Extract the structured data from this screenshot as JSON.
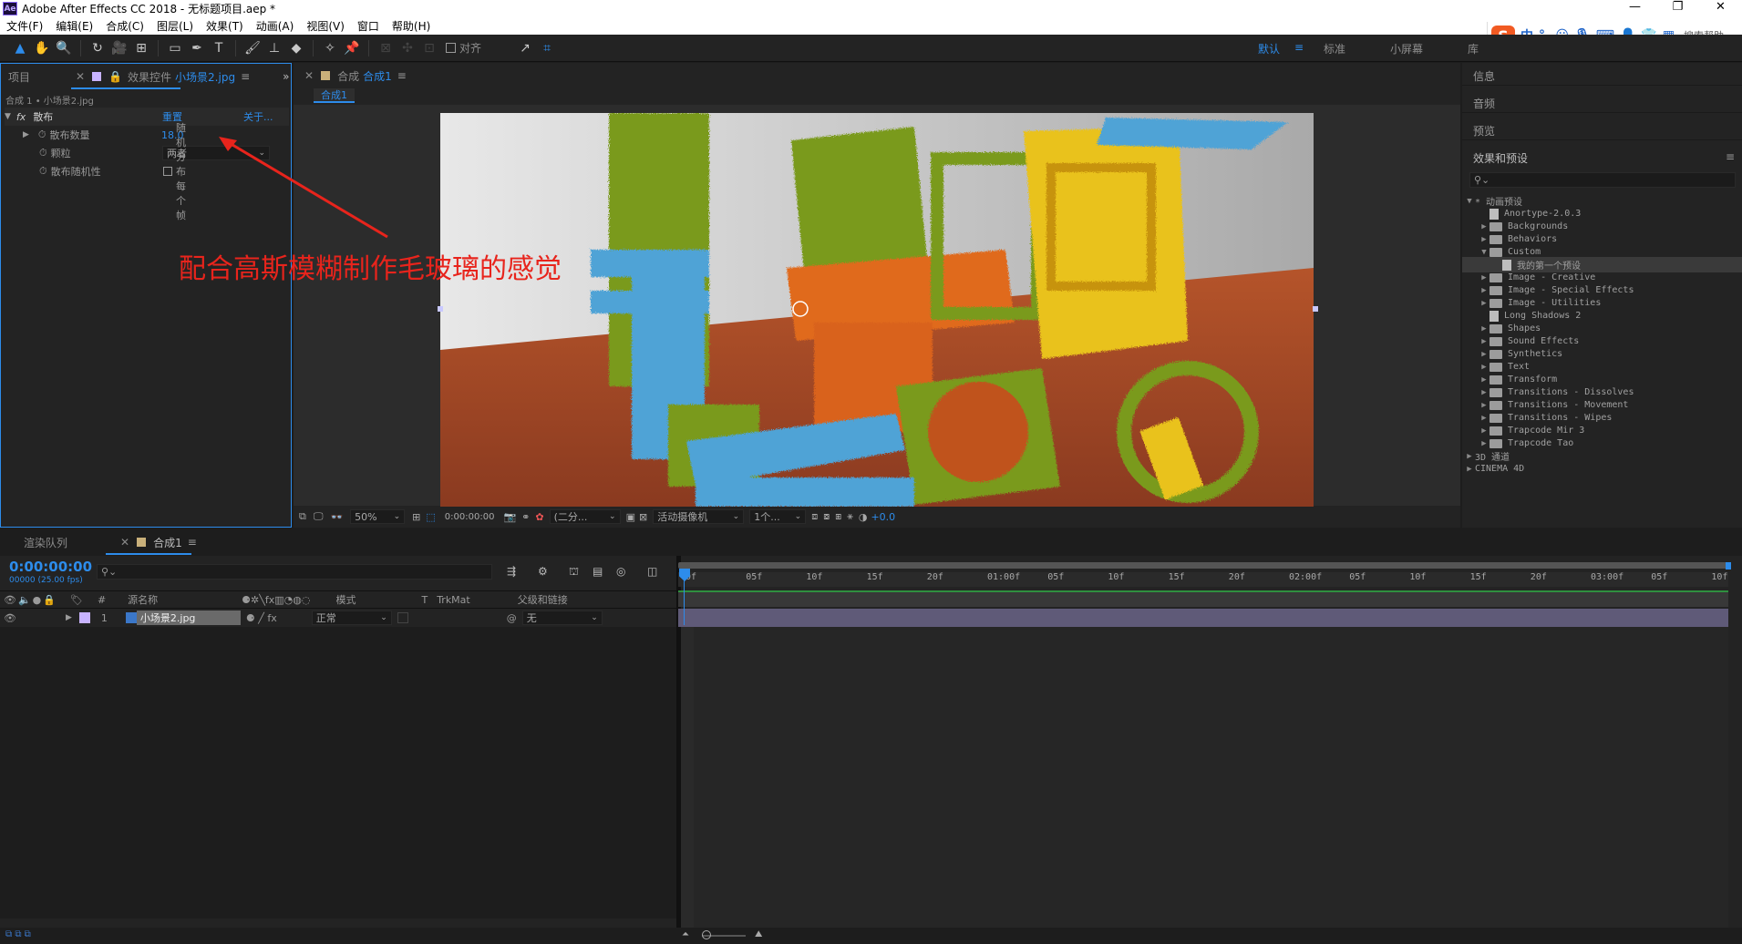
{
  "window": {
    "title": "Adobe After Effects CC 2018 - 无标题项目.aep *",
    "app_icon": "Ae",
    "controls": [
      "—",
      "❐",
      "✕"
    ]
  },
  "menu": [
    "文件(F)",
    "编辑(E)",
    "合成(C)",
    "图层(L)",
    "效果(T)",
    "动画(A)",
    "视图(V)",
    "窗口",
    "帮助(H)"
  ],
  "ime": {
    "mode": "中",
    "hint": "搜索帮助"
  },
  "toolbar": {
    "snap_label": "对齐",
    "workspaces": [
      "默认",
      "标准",
      "小屏幕",
      "库"
    ]
  },
  "effects_panel": {
    "tab_project": "项目",
    "tab_label": "效果控件",
    "layer_name": "小场景2.jpg",
    "breadcrumb": "合成 1 • 小场景2.jpg",
    "effect_name": "散布",
    "reset": "重置",
    "about": "关于...",
    "params": [
      {
        "label": "散布数量",
        "value": "18.0"
      },
      {
        "label": "颗粒",
        "value": "两者"
      },
      {
        "label": "散布随机性",
        "value": "随机分布每个帧"
      }
    ]
  },
  "annotation": "配合高斯模糊制作毛玻璃的感觉",
  "comp_panel": {
    "tab_prefix": "合成",
    "tab_name": "合成1",
    "subtab": "合成1",
    "zoom": "50%",
    "timecode": "0:00:00:00",
    "resolution": "(二分...",
    "camera": "活动摄像机",
    "views": "1个...",
    "exposure": "+0.0"
  },
  "right_panel": {
    "info": "信息",
    "audio": "音频",
    "preview": "预览",
    "effects_presets": "效果和预设",
    "tree": [
      {
        "label": "* 动画预设",
        "type": "root"
      },
      {
        "label": "Anortype-2.0.3",
        "type": "file",
        "depth": 1
      },
      {
        "label": "Backgrounds",
        "type": "folder",
        "depth": 1
      },
      {
        "label": "Behaviors",
        "type": "folder",
        "depth": 1
      },
      {
        "label": "Custom",
        "type": "folder-open",
        "depth": 1
      },
      {
        "label": "我的第一个预设",
        "type": "file-selected",
        "depth": 2
      },
      {
        "label": "Image - Creative",
        "type": "folder",
        "depth": 1
      },
      {
        "label": "Image - Special Effects",
        "type": "folder",
        "depth": 1
      },
      {
        "label": "Image - Utilities",
        "type": "folder",
        "depth": 1
      },
      {
        "label": "Long Shadows 2",
        "type": "file",
        "depth": 1
      },
      {
        "label": "Shapes",
        "type": "folder",
        "depth": 1
      },
      {
        "label": "Sound Effects",
        "type": "folder",
        "depth": 1
      },
      {
        "label": "Synthetics",
        "type": "folder",
        "depth": 1
      },
      {
        "label": "Text",
        "type": "folder",
        "depth": 1
      },
      {
        "label": "Transform",
        "type": "folder",
        "depth": 1
      },
      {
        "label": "Transitions - Dissolves",
        "type": "folder",
        "depth": 1
      },
      {
        "label": "Transitions - Movement",
        "type": "folder",
        "depth": 1
      },
      {
        "label": "Transitions - Wipes",
        "type": "folder",
        "depth": 1
      },
      {
        "label": "Trapcode Mir 3",
        "type": "folder",
        "depth": 1
      },
      {
        "label": "Trapcode Tao",
        "type": "folder",
        "depth": 1
      },
      {
        "label": "3D 通道",
        "type": "root-closed"
      },
      {
        "label": "CINEMA 4D",
        "type": "root-closed"
      }
    ]
  },
  "timeline": {
    "tab_render": "渲染队列",
    "tab_comp": "合成1",
    "timecode": "0:00:00:00",
    "fps": "00000 (25.00 fps)",
    "columns": {
      "num": "#",
      "source": "源名称",
      "mode": "模式",
      "t": "T",
      "trkmat": "TrkMat",
      "parent": "父级和链接"
    },
    "layer": {
      "index": "1",
      "name": "小场景2.jpg",
      "mode": "正常",
      "parent": "无"
    },
    "ruler": [
      "0f",
      "05f",
      "10f",
      "15f",
      "20f",
      "01:00f",
      "05f",
      "10f",
      "15f",
      "20f",
      "02:00f",
      "05f",
      "10f",
      "15f",
      "20f",
      "03:00f",
      "05f",
      "10f"
    ]
  },
  "colors": {
    "accent": "#2d8ceb",
    "annotation": "#e8241c",
    "layer_bar": "#5f5a78"
  }
}
